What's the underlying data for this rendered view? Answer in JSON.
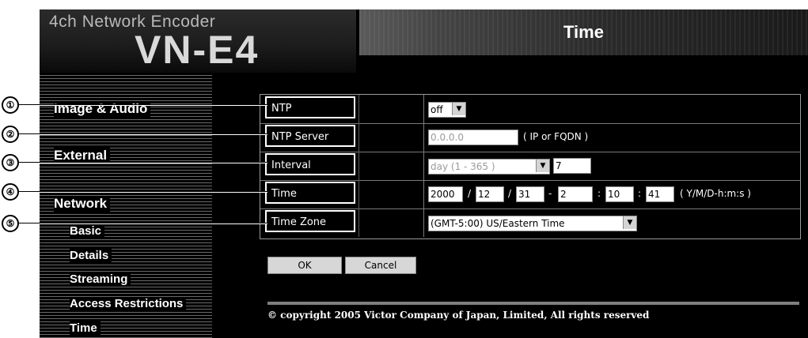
{
  "brand": {
    "subtitle": "4ch Network Encoder",
    "model": "VN-E4"
  },
  "header": {
    "title": "Time"
  },
  "sidebar": {
    "items": [
      {
        "label": "Image & Audio"
      },
      {
        "label": "External"
      },
      {
        "label": "Network"
      },
      {
        "label": "Basic"
      },
      {
        "label": "Details"
      },
      {
        "label": "Streaming"
      },
      {
        "label": "Access Restrictions"
      },
      {
        "label": "Time"
      }
    ]
  },
  "settings": {
    "ntp": {
      "label": "NTP",
      "value": "off"
    },
    "ntp_server": {
      "label": "NTP Server",
      "value": "0.0.0.0",
      "hint": "( IP or FQDN )"
    },
    "interval": {
      "label": "Interval",
      "unit": "day (1 - 365 )",
      "value": "7"
    },
    "time": {
      "label": "Time",
      "year": "2000",
      "month": "12",
      "day": "31",
      "hour": "2",
      "minute": "10",
      "second": "41",
      "sep_slash": "/",
      "sep_dash": "-",
      "sep_colon": ":",
      "hint": "( Y/M/D-h:m:s )"
    },
    "timezone": {
      "label": "Time Zone",
      "value": "(GMT-5:00) US/Eastern Time"
    }
  },
  "buttons": {
    "ok": "OK",
    "cancel": "Cancel"
  },
  "footer": {
    "copyright": "© copyright 2005 Victor Company of Japan, Limited, All rights reserved"
  },
  "callouts": [
    "①",
    "②",
    "③",
    "④",
    "⑤"
  ]
}
